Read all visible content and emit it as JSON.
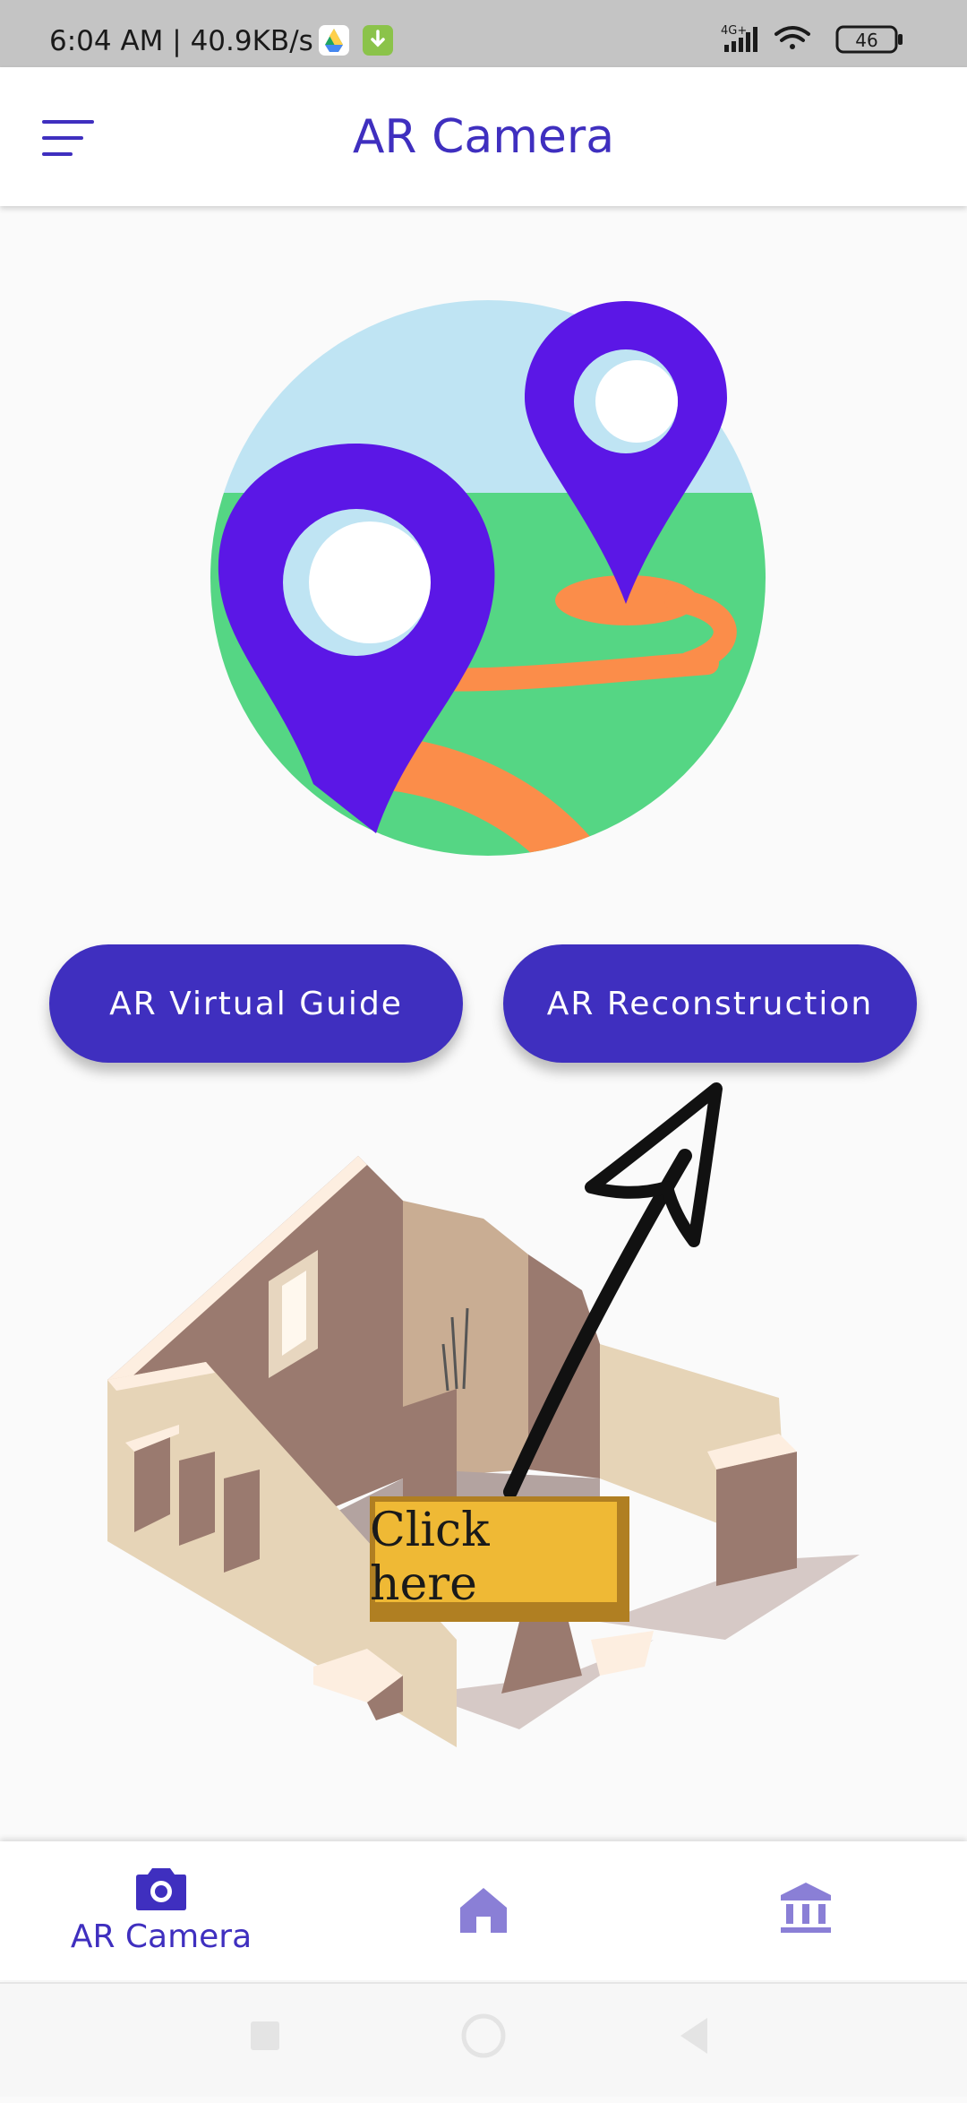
{
  "status_bar": {
    "time": "6:04 AM | 40.9KB/s",
    "network": "4G+",
    "battery": "46"
  },
  "app_bar": {
    "title": "AR Camera"
  },
  "buttons": {
    "virtual_guide": "AR Virtual Guide",
    "reconstruction": "AR Reconstruction"
  },
  "annotation": {
    "click_here": "Click here"
  },
  "bottom_nav": {
    "items": [
      {
        "label": "AR Camera",
        "icon": "camera-icon",
        "active": true
      },
      {
        "label": "",
        "icon": "home-icon",
        "active": false
      },
      {
        "label": "",
        "icon": "museum-icon",
        "active": false
      }
    ]
  },
  "colors": {
    "primary": "#3f2fbf",
    "pin": "#5b17e6",
    "grass": "#55d684",
    "sky": "#bfe4f3",
    "road": "#fb8d4a",
    "sign": "#efb935"
  }
}
